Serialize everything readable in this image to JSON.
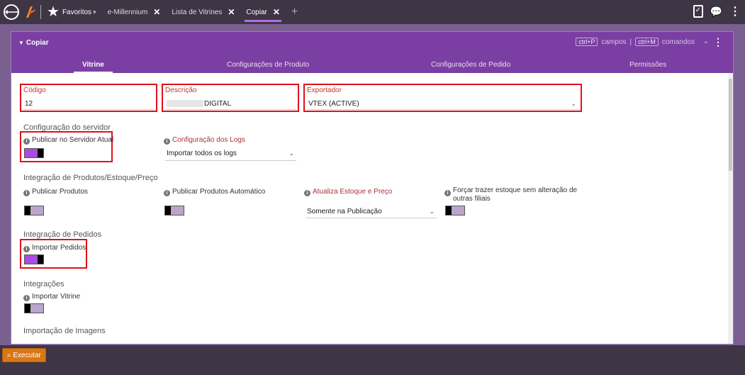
{
  "topbar": {
    "favorites_label": "Favoritos",
    "tabs": [
      {
        "label": "e-Millennium",
        "close": "✕"
      },
      {
        "label": "Lista de Vitrines",
        "close": "✕"
      },
      {
        "label": "Copiar",
        "close": "✕"
      }
    ],
    "add_tab": "+"
  },
  "panel": {
    "title": "Copiar",
    "shortcuts": {
      "key1": "ctrl+P",
      "label1": "campos",
      "separator": "|",
      "key2": "ctrl+M",
      "label2": "comandos"
    },
    "subtabs": [
      "Vitrine",
      "Configurações de Produto",
      "Configurações de Pedido",
      "Permissões"
    ]
  },
  "form": {
    "codigo": {
      "label": "Código",
      "value": "12"
    },
    "descricao": {
      "label": "Descrição",
      "value": "DIGITAL"
    },
    "exportador": {
      "label": "Exportador",
      "value": "VTEX (ACTIVE)"
    },
    "sections": {
      "servidor": "Configuração do servidor",
      "produtos": "Integração de Produtos/Estoque/Preço",
      "pedidos": "Integração de Pedidos",
      "integracoes": "Integrações",
      "imagens": "Importação de Imagens"
    },
    "options": {
      "publicar_servidor": "Publicar no Servidor Atual",
      "config_logs": "Configuração dos Logs",
      "config_logs_value": "Importar todos os logs",
      "publicar_produtos": "Publicar Produtos",
      "publicar_automatico": "Publicar Produtos Automático",
      "atualiza_estoque": "Atualiza Estoque e Preço",
      "atualiza_estoque_value": "Somente na Publicação",
      "forcar_estoque": "Forçar trazer estoque sem alteração de outras filiais",
      "importar_pedidos": "Importar Pedidos",
      "importar_vitrine": "Importar Vitrine"
    },
    "toggles": {
      "publicar_servidor": 1,
      "publicar_produtos": 0,
      "publicar_automatico": 0,
      "forcar_estoque": 0,
      "importar_pedidos": 1,
      "importar_vitrine": 0
    }
  },
  "bottombar": {
    "execute_label": "Executar"
  },
  "colors": {
    "accent": "#7b3fa3",
    "highlight": "#e0101b",
    "toggle_on": "#a94de0",
    "execute": "#d97717"
  }
}
